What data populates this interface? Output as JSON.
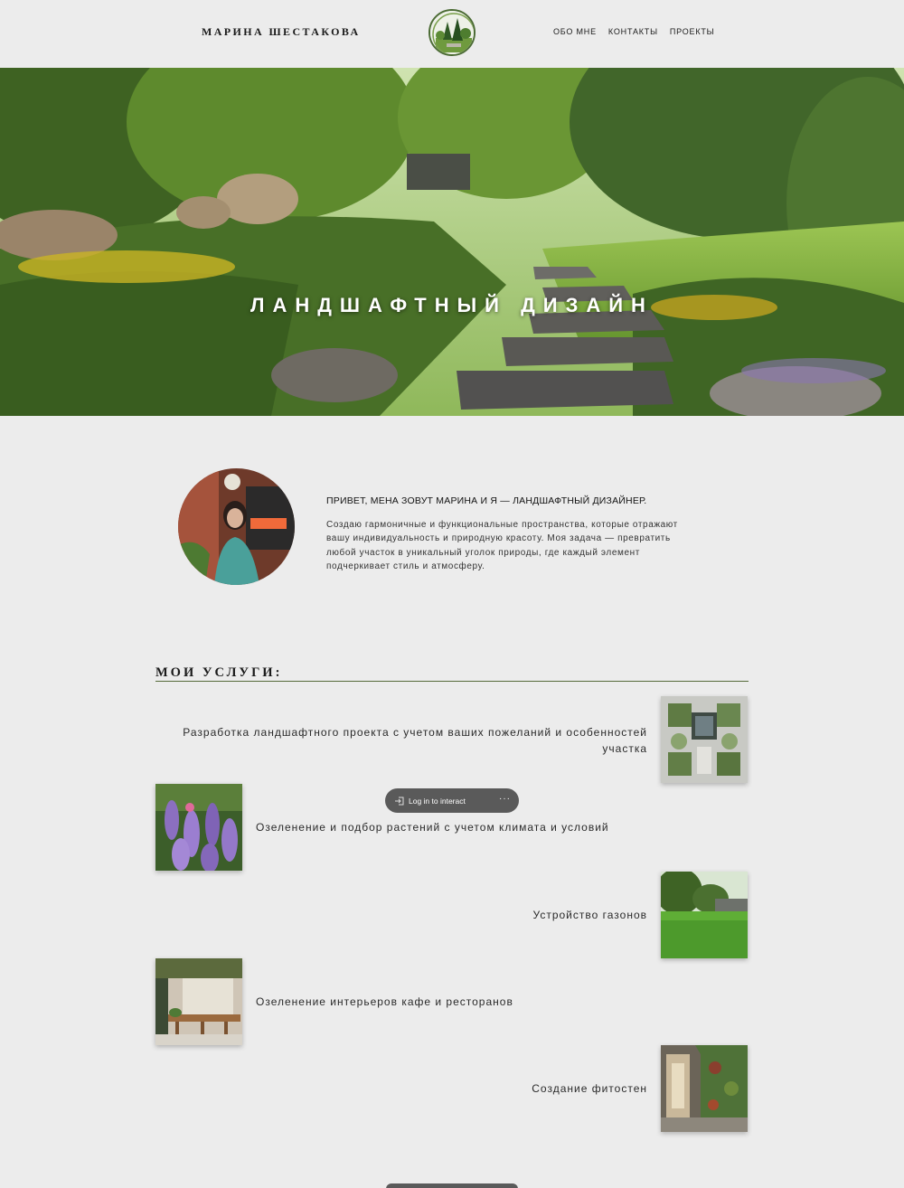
{
  "header": {
    "brand": "МАРИНА ШЕСТАКОВА",
    "logo_icon": "garden-logo-icon",
    "nav": [
      "ОБО МНЕ",
      "КОНТАКТЫ",
      "ПРОЕКТЫ"
    ]
  },
  "hero": {
    "title": "ЛАНДШАФТНЫЙ ДИЗАЙН",
    "image": "garden-stone-path-photo"
  },
  "about": {
    "photo": "portrait-photo",
    "heading": "ПРИВЕТ, МЕНА ЗОВУТ МАРИНА И Я — ЛАНДШАФТНЫЙ ДИЗАЙНЕР.",
    "text": "Создаю гармоничные и функциональные пространства, которые отражают вашу индивидуальность и природную красоту. Моя задача — превратить любой участок в уникальный уголок природы, где каждый элемент подчеркивает стиль и атмосферу."
  },
  "services": {
    "title": "МОИ УСЛУГИ:",
    "items": [
      {
        "text": "Разработка ландшафтного проекта с учетом ваших пожеланий и особенностей участка",
        "image": "landscape-plan-photo"
      },
      {
        "text": "Озеленение и подбор растений с учетом климата и условий",
        "image": "lavender-photo"
      },
      {
        "text": "Устройство газонов",
        "image": "lawn-photo"
      },
      {
        "text": "Озеленение интерьеров кафе и ресторанов",
        "image": "cafe-interior-photo"
      },
      {
        "text": "Создание фитостен",
        "image": "green-wall-photo"
      }
    ]
  },
  "overlay": {
    "login_label": "Log in to interact",
    "more_label": "···"
  },
  "colors": {
    "background": "#ececec",
    "accent": "#566b3a",
    "pill": "#5a5a5a"
  }
}
